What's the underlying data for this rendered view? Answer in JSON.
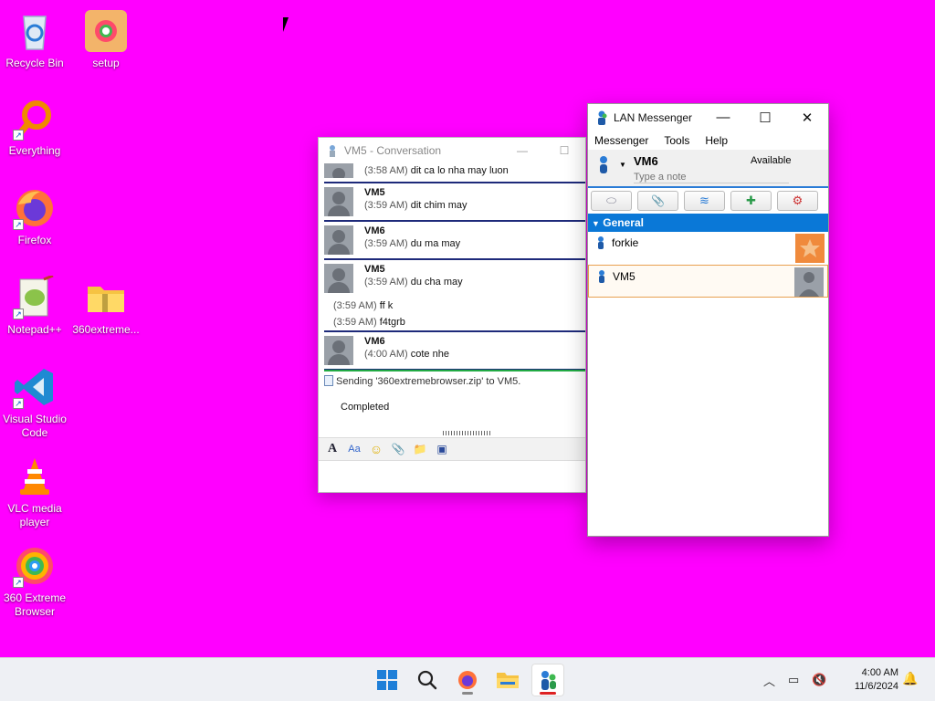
{
  "desktop": {
    "icons": [
      {
        "label": "Recycle Bin",
        "icon": "recycle-bin-icon"
      },
      {
        "label": "setup",
        "icon": "setup-icon"
      },
      {
        "label": "Everything",
        "icon": "everything-icon"
      },
      {
        "label": "Firefox",
        "icon": "firefox-icon"
      },
      {
        "label": "Notepad++",
        "icon": "notepad-plus-plus-icon"
      },
      {
        "label": "360extreme...",
        "icon": "zip-folder-icon"
      },
      {
        "label": "Visual Studio Code",
        "icon": "vscode-icon"
      },
      {
        "label": "VLC media player",
        "icon": "vlc-icon"
      },
      {
        "label": "360 Extreme Browser",
        "icon": "360-browser-icon"
      }
    ]
  },
  "conversation": {
    "title": "VM5 - Conversation",
    "messages": [
      {
        "sender": "",
        "time": "(3:58 AM)",
        "text": "dit ca lo nha may luon"
      },
      {
        "sender": "VM5",
        "time": "(3:59 AM)",
        "text": "dit chim may"
      },
      {
        "sender": "VM6",
        "time": "(3:59 AM)",
        "text": "du ma may"
      },
      {
        "sender": "VM5",
        "time": "(3:59 AM)",
        "text": "du cha may",
        "extra": [
          {
            "time": "(3:59 AM)",
            "text": "ff k"
          },
          {
            "time": "(3:59 AM)",
            "text": "f4tgrb"
          }
        ]
      },
      {
        "sender": "VM6",
        "time": "(4:00 AM)",
        "text": "cote nhe"
      }
    ],
    "file_transfer": {
      "text": "Sending '360extremebrowser.zip' to VM5.",
      "status": "Completed"
    }
  },
  "lan": {
    "title": "LAN Messenger",
    "menu": [
      "Messenger",
      "Tools",
      "Help"
    ],
    "user": {
      "name": "VM6",
      "status": "Available",
      "note_placeholder": "Type a note"
    },
    "group": "General",
    "contacts": [
      {
        "name": "forkie",
        "selected": false
      },
      {
        "name": "VM5",
        "selected": true
      }
    ]
  },
  "taskbar": {
    "clock_time": "4:00 AM",
    "clock_date": "11/6/2024"
  },
  "colors": {
    "desktop": "#ff00ff",
    "group_header": "#0a78d7",
    "message_divider": "#1e2a7a",
    "transfer_divider": "#22aa44"
  }
}
